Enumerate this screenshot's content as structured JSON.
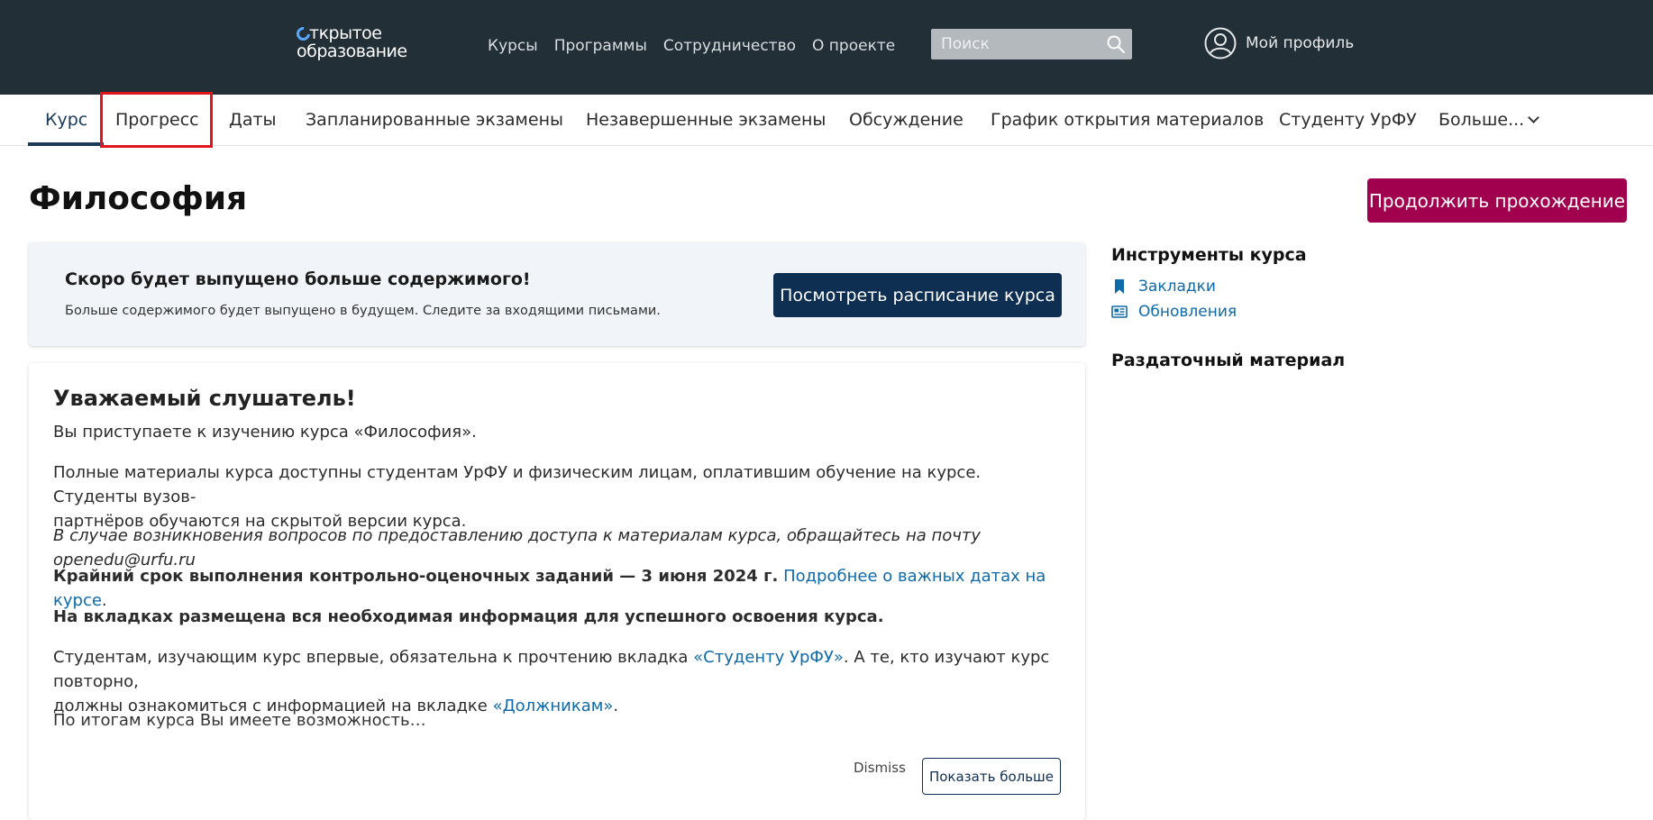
{
  "header": {
    "logo_line1": "ткрытое",
    "logo_line2": "образование",
    "nav": [
      "Курсы",
      "Программы",
      "Сотрудничество",
      "О проекте"
    ],
    "search_placeholder": "Поиск",
    "profile_label": "Мой профиль"
  },
  "tabs": [
    "Курс",
    "Прогресс",
    "Даты",
    "Запланированные экзамены",
    "Незавершенные экзамены",
    "Обсуждение",
    "График открытия материалов",
    "Студенту УрФУ",
    "Больше..."
  ],
  "active_tab": "Курс",
  "highlighted_tab": "Прогресс",
  "page": {
    "title": "Философия",
    "resume_button": "Продолжить прохождение"
  },
  "alert": {
    "title": "Скоро будет выпущено больше содержимого!",
    "text": "Больше содержимого будет выпущено в будущем. Следите за входящими письмами.",
    "button": "Посмотреть расписание курса"
  },
  "welcome": {
    "heading": "Уважаемый слушатель!",
    "p1": "Вы приступаете к изучению курса «Философия».",
    "p2_line1": "Полные материалы курса доступны студентам УрФУ и физическим лицам, оплатившим обучение на курсе. Студенты вузов-",
    "p2_line2": "партнёров обучаются на скрытой версии курса.",
    "p3": "В случае возникновения вопросов по предоставлению доступа к материалам курса, обращайтесь на почту openedu@urfu.ru",
    "p4_bold": "Крайний срок выполнения контрольно-оценочных заданий — 3 июня 2024 г.",
    "p4_link": "Подробнее о важных датах на курсе",
    "p4_end": ".",
    "p5": "На вкладках размещена вся необходимая информация для успешного освоения курса.",
    "p6_a": "Студентам, изучающим курс впервые, обязательна к прочтению вкладка ",
    "p6_link1": "«Студенту УрФУ»",
    "p6_b": ". А те, кто изучают курс повторно,",
    "p6_c": "должны ознакомиться с информацией на вкладке ",
    "p6_link2": "«Должникам»",
    "p6_d": ".",
    "p7": "По итогам курса Вы имеете возможность…",
    "dismiss": "Dismiss",
    "show_more": "Показать больше"
  },
  "sidebar": {
    "tools_title": "Инструменты курса",
    "bookmarks": "Закладки",
    "updates": "Обновления",
    "handouts_title": "Раздаточный материал"
  },
  "colors": {
    "header_bg": "#222f36",
    "brand_button": "#a0004e",
    "navy_button": "#0e2e52",
    "link": "#0e6aa8",
    "highlight_box": "#e0161c"
  }
}
